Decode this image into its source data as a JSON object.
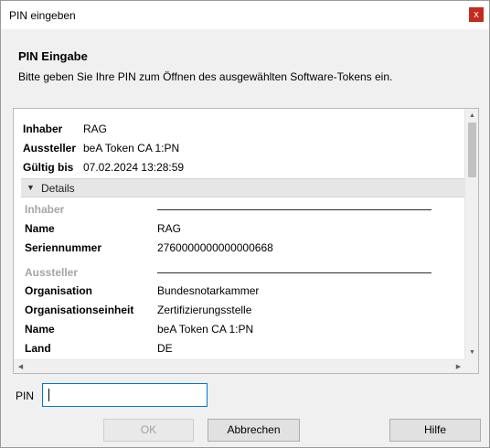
{
  "window": {
    "title": "PIN eingeben",
    "close_glyph": "x"
  },
  "header": {
    "title": "PIN Eingabe",
    "subtitle": "Bitte geben Sie Ihre PIN zum Öffnen des ausgewählten Software-Tokens ein."
  },
  "summary": [
    {
      "label": "Inhaber",
      "value": "RAG"
    },
    {
      "label": "Aussteller",
      "value": "beA Token CA 1:PN"
    },
    {
      "label": "Gültig bis",
      "value": "07.02.2024 13:28:59"
    }
  ],
  "details": {
    "label": "Details",
    "inhaber_section": "Inhaber",
    "inhaber_rows": [
      {
        "label": "Name",
        "value": "RAG"
      },
      {
        "label": "Seriennummer",
        "value": "2760000000000000668"
      }
    ],
    "aussteller_section": "Aussteller",
    "aussteller_rows": [
      {
        "label": "Organisation",
        "value": "Bundesnotarkammer"
      },
      {
        "label": "Organisationseinheit",
        "value": "Zertifizierungsstelle"
      },
      {
        "label": "Name",
        "value": "beA Token CA 1:PN"
      },
      {
        "label": "Land",
        "value": "DE"
      }
    ]
  },
  "pin": {
    "label": "PIN",
    "value": ""
  },
  "buttons": {
    "ok": "OK",
    "cancel": "Abbrechen",
    "help": "Hilfe"
  },
  "icons": {
    "close": "close-icon",
    "expand": "triangle-down-icon",
    "scroll_up": "scroll-up-arrow-icon",
    "scroll_down": "scroll-down-arrow-icon",
    "scroll_left": "scroll-left-arrow-icon",
    "scroll_right": "scroll-right-arrow-icon"
  },
  "colors": {
    "accent": "#0078d7",
    "close": "#c42b1c",
    "muted_section": "#a5a5a5"
  }
}
